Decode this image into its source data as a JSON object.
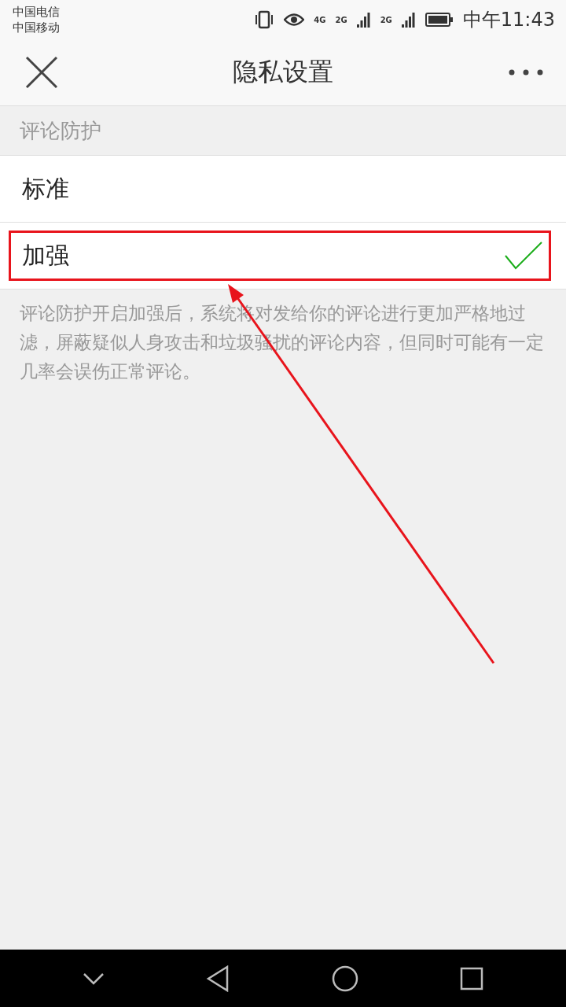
{
  "status_bar": {
    "carriers": [
      "中国电信",
      "中国移动"
    ],
    "network_labels": [
      "4G",
      "2G",
      "2G"
    ],
    "time": "中午11:43"
  },
  "header": {
    "title": "隐私设置"
  },
  "section": {
    "title": "评论防护",
    "options": [
      {
        "label": "标准",
        "selected": false,
        "highlighted": false
      },
      {
        "label": "加强",
        "selected": true,
        "highlighted": true
      }
    ],
    "description": "评论防护开启加强后，系统将对发给你的评论进行更加严格地过滤，屏蔽疑似人身攻击和垃圾骚扰的评论内容，但同时可能有一定几率会误伤正常评论。"
  }
}
